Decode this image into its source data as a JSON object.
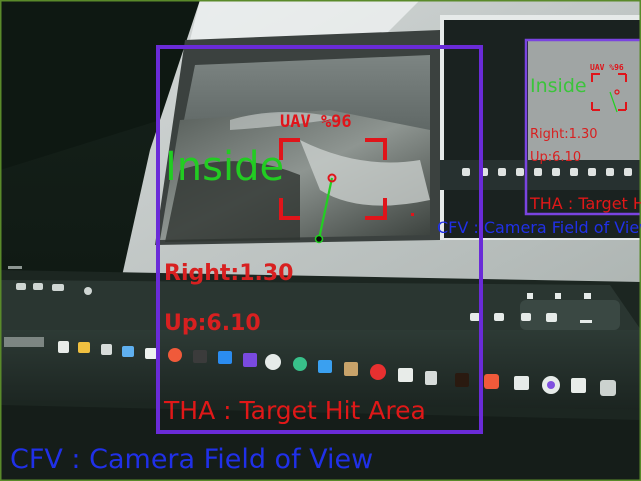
{
  "overlay": {
    "detection_label": "UAV %96",
    "status_label": "Inside",
    "right_offset": "Right:1.30",
    "up_offset": "Up:6.10",
    "tha_caption": "THA : Target Hit Area",
    "cfv_caption": "CFV : Camera Field of View"
  },
  "recursive_preview": {
    "detection_label": "UAV %96",
    "status_label": "Inside",
    "right_offset": "Right:1.30",
    "up_offset": "Up:6.10",
    "tha_caption": "THA : Target Hit Area",
    "cfv_caption": "CFV : Camera Field of View"
  },
  "colors": {
    "fov_frame": "#6a2bd8",
    "target_box": "#e0141a",
    "status_text": "#22cc22",
    "offset_text": "#d82020",
    "tha_text": "#e01818",
    "cfv_text": "#2030e8",
    "vector_line": "#22d022",
    "outer_border": "#5a8a2a"
  }
}
